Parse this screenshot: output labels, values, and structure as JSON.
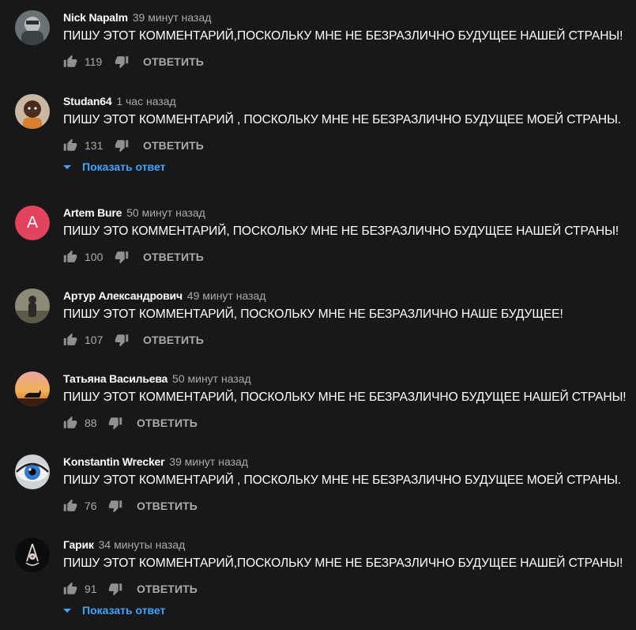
{
  "comments": [
    {
      "author": "Nick Napalm",
      "time": "39 минут назад",
      "text": "ПИШУ ЭТОТ КОММЕНТАРИЙ,ПОСКОЛЬКУ МНЕ НЕ БЕЗРАЗЛИЧНО БУДУЩЕЕ НАШЕЙ СТРАНЫ!",
      "likes": "119",
      "reply_label": "ОТВЕТИТЬ"
    },
    {
      "author": "Studan64",
      "time": "1 час назад",
      "text": "ПИШУ ЭТОТ КОММЕНТАРИЙ , ПОСКОЛЬКУ МНЕ НЕ БЕЗРАЗЛИЧНО БУДУЩЕЕ МОЕЙ СТРАНЫ.",
      "likes": "131",
      "reply_label": "ОТВЕТИТЬ",
      "show_replies": "Показать ответ"
    },
    {
      "author": "Artem Bure",
      "time": "50 минут назад",
      "text": "ПИШУ ЭТО КОММЕНТАРИЙ, ПОСКОЛЬКУ МНЕ НЕ БЕЗРАЗЛИЧНО БУДУЩЕЕ НАШЕЙ СТРАНЫ!",
      "likes": "100",
      "reply_label": "ОТВЕТИТЬ",
      "avatar_letter": "A",
      "avatar_color": "#e2435d"
    },
    {
      "author": "Артур Александрович",
      "time": "49 минут назад",
      "text": "ПИШУ ЭТОТ КОММЕНТАРИЙ, ПОСКОЛЬКУ МНЕ НЕ БЕЗРАЗЛИЧНО НАШЕ БУДУЩЕЕ!",
      "likes": "107",
      "reply_label": "ОТВЕТИТЬ"
    },
    {
      "author": "Татьяна Васильева",
      "time": "50 минут назад",
      "text": "ПИШУ ЭТОТ КОММЕНТАРИЙ, ПОСКОЛЬКУ МНЕ НЕ БЕЗРАЗЛИЧНО БУДУЩЕЕ НАШЕЙ СТРАНЫ!",
      "likes": "88",
      "reply_label": "ОТВЕТИТЬ"
    },
    {
      "author": "Konstantin Wrecker",
      "time": "39 минут назад",
      "text": "ПИШУ ЭТОТ КОММЕНТАРИЙ , ПОСКОЛЬКУ МНЕ НЕ БЕЗРАЗЛИЧНО БУДУЩЕЕ МОЕЙ СТРАНЫ.",
      "likes": "76",
      "reply_label": "ОТВЕТИТЬ"
    },
    {
      "author": "Гарик",
      "time": "34 минуты назад",
      "text": "ПИШУ ЭТОТ КОММЕНТАРИЙ,ПОСКОЛЬКУ МНЕ НЕ БЕЗРАЗЛИЧНО БУДУЩЕЕ НАШЕЙ СТРАНЫ!",
      "likes": "91",
      "reply_label": "ОТВЕТИТЬ",
      "show_replies": "Показать ответ"
    }
  ],
  "colors": {
    "background": "#181818",
    "link": "#3ea6ff",
    "muted": "#aaaaaa"
  },
  "icons": {
    "like": "thumbs-up-icon",
    "dislike": "thumbs-down-icon",
    "expand": "caret-down-icon"
  }
}
